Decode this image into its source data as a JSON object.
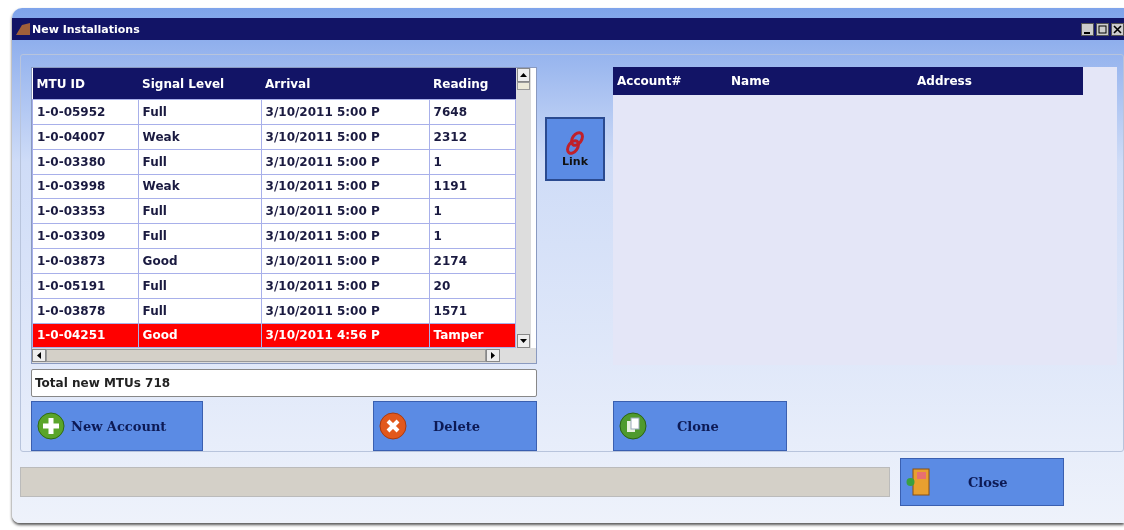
{
  "window": {
    "title": "New Installations"
  },
  "mtu_table": {
    "columns": [
      "MTU ID",
      "Signal Level",
      "Arrival",
      "Reading"
    ],
    "rows": [
      {
        "cells": [
          "1-0-05952",
          "Full",
          "3/10/2011 5:00 P",
          "7648"
        ],
        "selected": false
      },
      {
        "cells": [
          "1-0-04007",
          "Weak",
          "3/10/2011 5:00 P",
          "2312"
        ],
        "selected": false
      },
      {
        "cells": [
          "1-0-03380",
          "Full",
          "3/10/2011 5:00 P",
          "1"
        ],
        "selected": false
      },
      {
        "cells": [
          "1-0-03998",
          "Weak",
          "3/10/2011 5:00 P",
          "1191"
        ],
        "selected": false
      },
      {
        "cells": [
          "1-0-03353",
          "Full",
          "3/10/2011 5:00 P",
          "1"
        ],
        "selected": false
      },
      {
        "cells": [
          "1-0-03309",
          "Full",
          "3/10/2011 5:00 P",
          "1"
        ],
        "selected": false
      },
      {
        "cells": [
          "1-0-03873",
          "Good",
          "3/10/2011 5:00 P",
          "2174"
        ],
        "selected": false
      },
      {
        "cells": [
          "1-0-05191",
          "Full",
          "3/10/2011 5:00 P",
          "20"
        ],
        "selected": false
      },
      {
        "cells": [
          "1-0-03878",
          "Full",
          "3/10/2011 5:00 P",
          "1571"
        ],
        "selected": false
      },
      {
        "cells": [
          "1-0-04251",
          "Good",
          "3/10/2011 4:56 P",
          "Tamper"
        ],
        "selected": true
      }
    ]
  },
  "total_field": {
    "value": "Total new MTUs 718"
  },
  "link_button": {
    "label": "Link"
  },
  "account_table": {
    "columns": [
      "Account#",
      "Name",
      "Address"
    ]
  },
  "buttons": [
    {
      "label": "New Account",
      "kind": "add"
    },
    {
      "label": "Delete",
      "kind": "delete"
    },
    {
      "label": "Clone",
      "kind": "clone"
    }
  ],
  "close_button": {
    "label": "Close"
  }
}
